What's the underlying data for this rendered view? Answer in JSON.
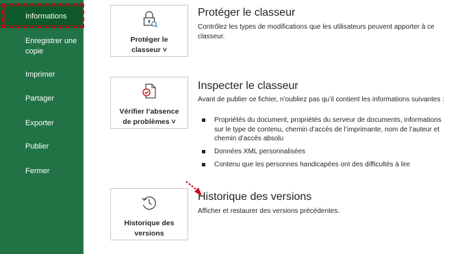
{
  "sidebar": {
    "items": [
      {
        "label": "Informations"
      },
      {
        "label": "Enregistrer une\ncopie"
      },
      {
        "label": "Imprimer"
      },
      {
        "label": "Partager"
      },
      {
        "label": "Exporter"
      },
      {
        "label": "Publier"
      },
      {
        "label": "Fermer"
      }
    ],
    "selected": "Informations"
  },
  "sections": {
    "protect": {
      "button_label": "Protéger le\nclasseur ˅",
      "icon": "lock-icon",
      "title": "Protéger le classeur",
      "description": "Contrôlez les types de modifications que les utilisateurs peuvent apporter à ce classeur."
    },
    "inspect": {
      "button_label": "Vérifier l’absence\nde problèmes ˅",
      "icon": "inspect-document-icon",
      "title": "Inspecter le classeur",
      "description": "Avant de publier ce fichier, n’oubliez pas qu’il contient les informations suivantes :",
      "bullets": [
        "Propriétés du document, propriétés du serveur de documents, informations sur le type de contenu, chemin d’accès de l’imprimante, nom de l’auteur et chemin d’accès absolu",
        "Données XML personnalisées",
        "Contenu que les personnes handicapées ont des difficultés à lire"
      ]
    },
    "versions": {
      "button_label": "Historique des\nversions",
      "icon": "version-history-icon",
      "title": "Historique des versions",
      "description": "Afficher et restaurer des versions précédentes."
    }
  },
  "colors": {
    "sidebar_bg": "#217346",
    "sidebar_selected": "#0f5a2c",
    "annotation_red": "#d0021b"
  }
}
